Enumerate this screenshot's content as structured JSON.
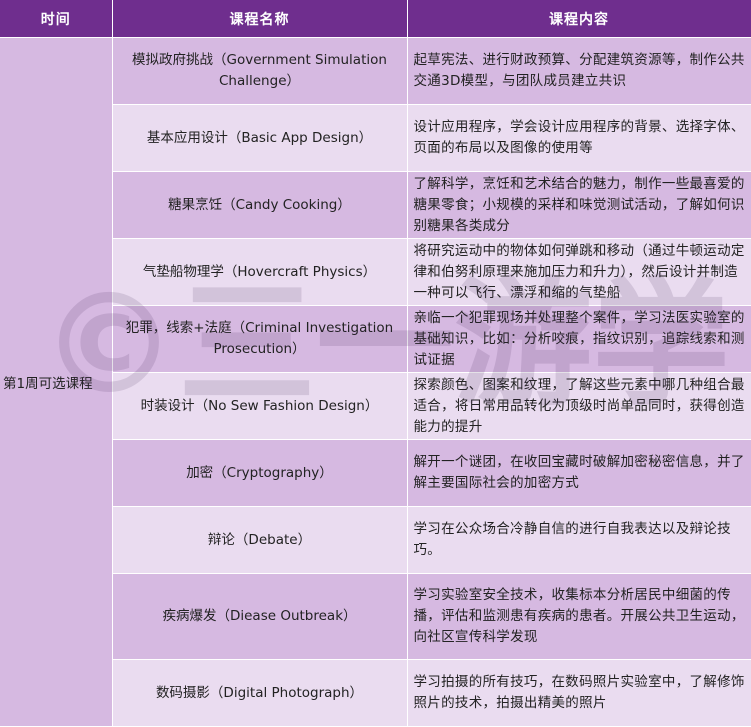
{
  "headers": {
    "time": "时间",
    "course_name": "课程名称",
    "course_content": "课程内容"
  },
  "week_label": "第1周可选课程",
  "rows": [
    {
      "name": "模拟政府挑战（Government Simulation Challenge）",
      "content": "起草宪法、进行财政预算、分配建筑资源等，制作公共交通3D模型，与团队成员建立共识"
    },
    {
      "name": "基本应用设计（Basic App Design）",
      "content": "设计应用程序，学会设计应用程序的背景、选择字体、页面的布局以及图像的使用等"
    },
    {
      "name": "糖果烹饪（Candy Cooking）",
      "content": "了解科学，烹饪和艺术结合的魅力，制作一些最喜爱的糖果零食；小规模的采样和味觉测试活动，了解如何识别糖果各类成分"
    },
    {
      "name": "气垫船物理学（Hovercraft Physics）",
      "content": "将研究运动中的物体如何弹跳和移动（通过牛顿运动定律和伯努利原理来施加压力和升力），然后设计并制造一种可以飞行、漂浮和缩的气垫船"
    },
    {
      "name": "犯罪，线索+法庭（Criminal Investigation Prosecution）",
      "content": "亲临一个犯罪现场并处理整个案件，学习法医实验室的基础知识，比如：分析咬痕，指纹识别，追踪线索和测试证据"
    },
    {
      "name": "时装设计（No Sew Fashion Design）",
      "content": "探索颜色、图案和纹理，了解这些元素中哪几种组合最适合，将日常用品转化为顶级时尚单品同时，获得创造能力的提升"
    },
    {
      "name": "加密（Cryptography）",
      "content": "解开一个谜团，在收回宝藏时破解加密秘密信息，并了解主要国际社会的加密方式"
    },
    {
      "name": "辩论（Debate）",
      "content": "学习在公众场合冷静自信的进行自我表达以及辩论技巧。"
    },
    {
      "name": "疾病爆发（Diease Outbreak）",
      "content": "学习实验室安全技术，收集标本分析居民中细菌的传播，评估和监测患有疾病的患者。开展公共卫生运动，向社区宣传科学发现"
    },
    {
      "name": "数码摄影（Digital Photograph）",
      "content": "学习拍摄的所有技巧，在数码照片实验室中，了解修饰照片的技术，拍摄出精美的照片"
    }
  ],
  "watermark": "©三一游学",
  "colors": {
    "header_bg": "#6f2e8e",
    "row_dark": "#d6b9e1",
    "row_light": "#eadcf0"
  }
}
